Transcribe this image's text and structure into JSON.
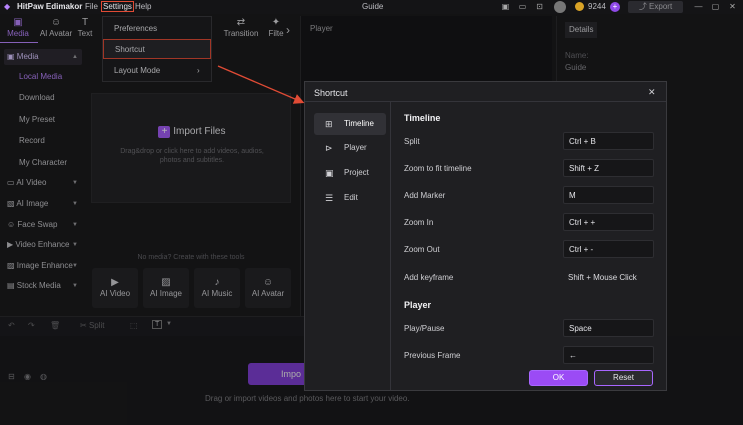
{
  "app": {
    "title": "HitPaw Edimakor",
    "center_title": "Guide",
    "coins": "9244",
    "export_label": "Export"
  },
  "menubar": {
    "file": "File",
    "settings": "Settings",
    "help": "Help"
  },
  "toolbar": [
    {
      "label": "Media",
      "icon": "media-icon"
    },
    {
      "label": "AI Avatar",
      "icon": "ai-avatar-icon"
    },
    {
      "label": "Text",
      "icon": "text-icon"
    },
    {
      "label": "Transition",
      "icon": "transition-icon"
    },
    {
      "label": "Filte",
      "icon": "filter-icon"
    }
  ],
  "sidebar": {
    "media": "Media",
    "sub": [
      "Local Media",
      "Download",
      "My Preset",
      "Record",
      "My Character"
    ],
    "groups": [
      "AI Video",
      "AI Image",
      "Face Swap",
      "Video Enhance",
      "Image Enhance",
      "Stock Media"
    ]
  },
  "import": {
    "label": "Import Files",
    "hint1": "Drag&drop or click here to add videos, audios,",
    "hint2": "photos and subtitles."
  },
  "tools": {
    "prompt": "No media? Create with these tools",
    "items": [
      "AI Video",
      "AI Image",
      "AI Music",
      "AI Avatar"
    ]
  },
  "timeline": {
    "split": "Split",
    "import_button": "Impo",
    "hint": "Drag or import videos and photos here to start your video."
  },
  "player": {
    "title": "Player"
  },
  "details": {
    "tab": "Details",
    "name_label": "Name:",
    "name_value": "Guide"
  },
  "settings_menu": {
    "items": [
      "Preferences",
      "Shortcut",
      "Layout Mode"
    ]
  },
  "dialog": {
    "title": "Shortcut",
    "categories": [
      "Timeline",
      "Player",
      "Project",
      "Edit"
    ],
    "timeline_section": "Timeline",
    "timeline_shortcuts": [
      {
        "label": "Split",
        "key": "Ctrl + B"
      },
      {
        "label": "Zoom to fit timeline",
        "key": "Shift + Z"
      },
      {
        "label": "Add Marker",
        "key": "M"
      },
      {
        "label": "Zoom In",
        "key": "Ctrl + +"
      },
      {
        "label": "Zoom Out",
        "key": "Ctrl + -"
      },
      {
        "label": "Add keyframe",
        "key": "Shift + Mouse Click"
      }
    ],
    "player_section": "Player",
    "player_shortcuts": [
      {
        "label": "Play/Pause",
        "key": "Space"
      },
      {
        "label": "Previous Frame",
        "key": "←"
      }
    ],
    "ok": "OK",
    "reset": "Reset"
  },
  "colors": {
    "accent": "#9b4bf5",
    "highlight": "#e04b35",
    "background": "#1b1b1d"
  }
}
